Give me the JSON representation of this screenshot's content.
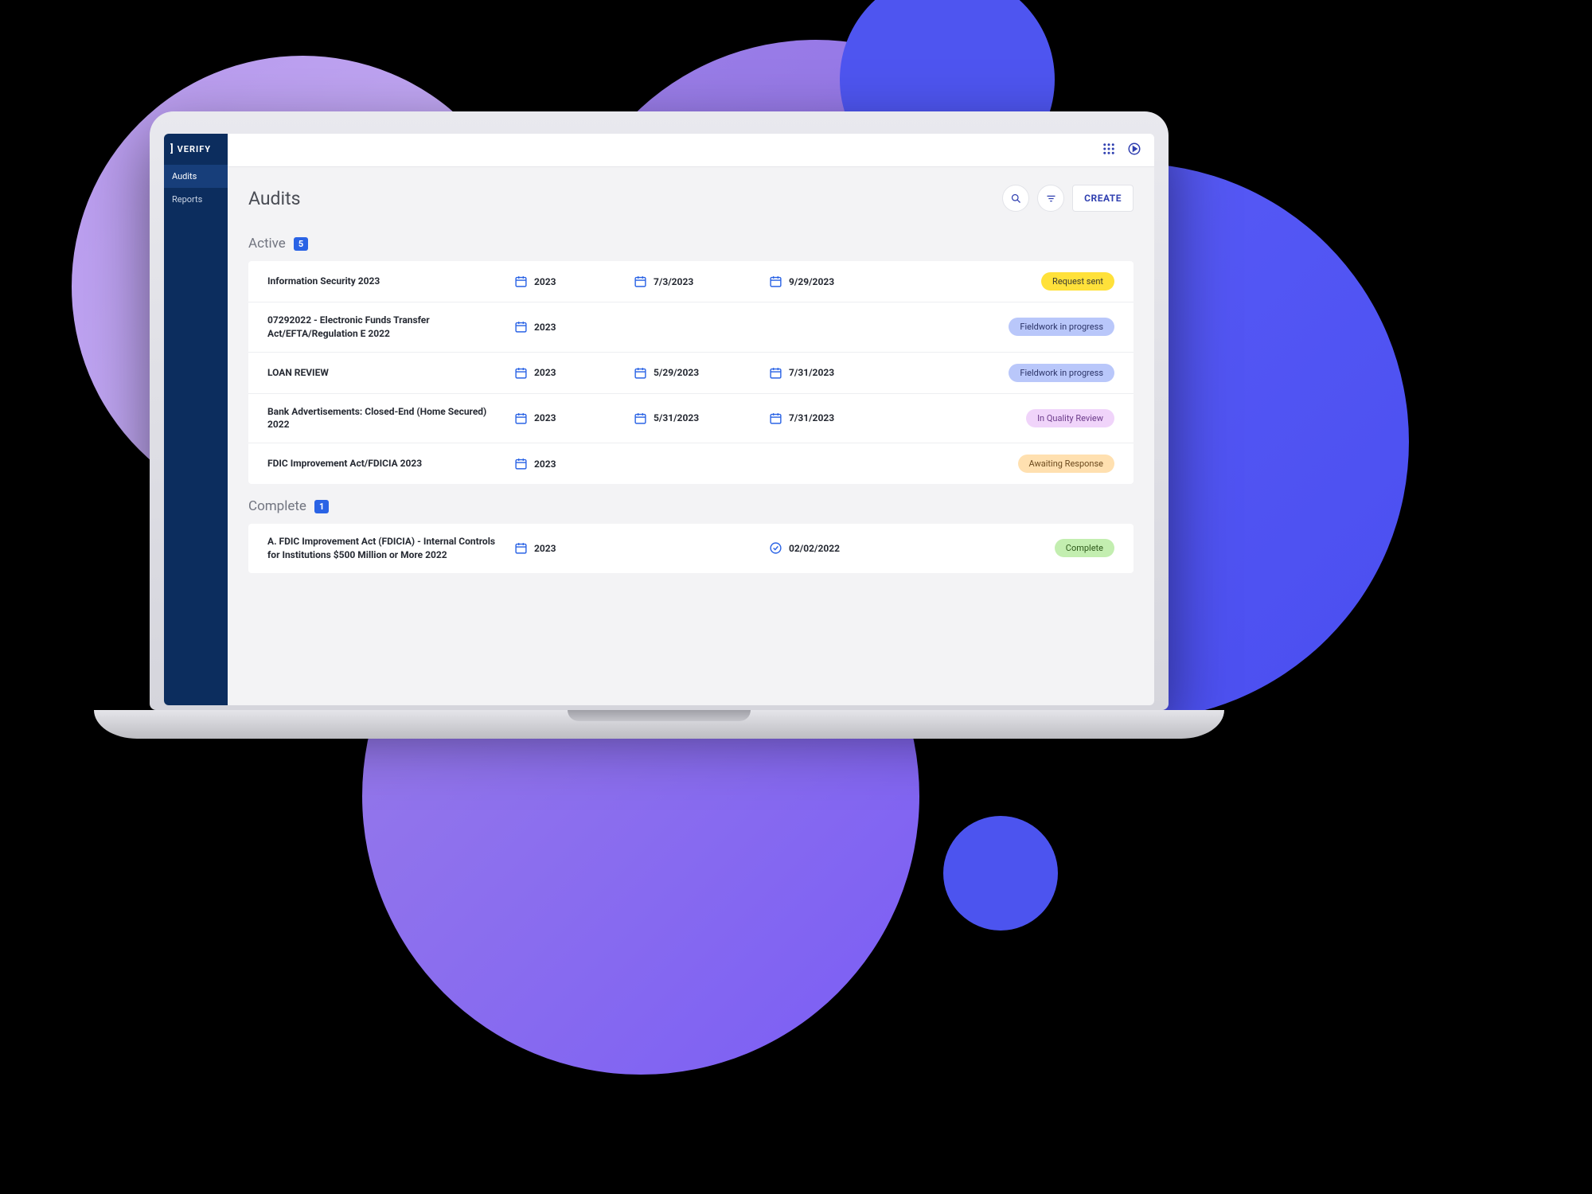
{
  "brand": "VERIFY",
  "sidebar": {
    "items": [
      {
        "label": "Audits"
      },
      {
        "label": "Reports"
      }
    ]
  },
  "page": {
    "title": "Audits",
    "create_label": "CREATE"
  },
  "sections": {
    "active": {
      "label": "Active",
      "count": "5"
    },
    "complete": {
      "label": "Complete",
      "count": "1"
    }
  },
  "audits_active": [
    {
      "title": "Information Security 2023",
      "year": "2023",
      "start": "7/3/2023",
      "end": "9/29/2023",
      "status": "Request sent",
      "status_class": "p-yellow"
    },
    {
      "title": "07292022 - Electronic Funds Transfer Act/EFTA/Regulation E 2022",
      "year": "2023",
      "start": "",
      "end": "",
      "status": "Fieldwork in progress",
      "status_class": "p-blue"
    },
    {
      "title": "LOAN REVIEW",
      "year": "2023",
      "start": "5/29/2023",
      "end": "7/31/2023",
      "status": "Fieldwork in progress",
      "status_class": "p-blue"
    },
    {
      "title": "Bank Advertisements: Closed-End (Home Secured) 2022",
      "year": "2023",
      "start": "5/31/2023",
      "end": "7/31/2023",
      "status": "In Quality Review",
      "status_class": "p-purple"
    },
    {
      "title": "FDIC Improvement Act/FDICIA 2023",
      "year": "2023",
      "start": "",
      "end": "",
      "status": "Awaiting Response",
      "status_class": "p-orange"
    }
  ],
  "audits_complete": [
    {
      "title": "A. FDIC Improvement Act (FDICIA) - Internal Controls for Institutions $500 Million or More 2022",
      "year": "2023",
      "done": "02/02/2022",
      "status": "Complete",
      "status_class": "p-green"
    }
  ]
}
